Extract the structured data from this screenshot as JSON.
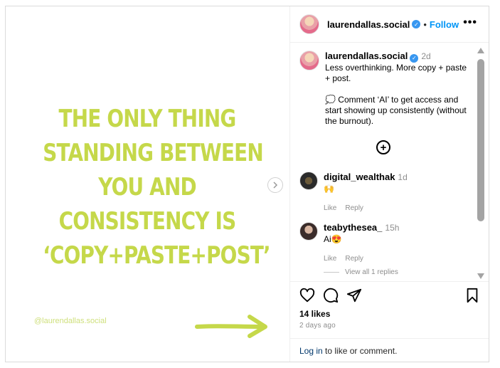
{
  "post": {
    "headline_lines": [
      "THE ONLY THING",
      "STANDING BETWEEN",
      "YOU AND",
      "CONSISTENCY IS",
      "‘COPY+PASTE+POST’"
    ],
    "watermark": "@laurendallas.social",
    "headline_color": "#c5d84a"
  },
  "header": {
    "username": "laurendallas.social",
    "separator": "•",
    "follow_label": "Follow",
    "more_label": "•••"
  },
  "caption": {
    "username": "laurendallas.social",
    "time": "2d",
    "text": "Less overthinking. More copy + paste + post.",
    "text2": "💭 Comment ‘AI’ to get access and start showing up consistently (without the burnout).",
    "add_label": "+"
  },
  "comments": [
    {
      "username": "digital_wealthak",
      "time": "1d",
      "text": "🙌",
      "like": "Like",
      "reply": "Reply"
    },
    {
      "username": "teabythesea_",
      "time": "15h",
      "text": "Ai😍",
      "like": "Like",
      "reply": "Reply"
    }
  ],
  "view_replies": "View all 1 replies",
  "likes": "14 likes",
  "ago": "2 days ago",
  "login": {
    "link": "Log in",
    "rest": " to like or comment."
  },
  "colors": {
    "accent": "#0095f6",
    "verified": "#3897f0",
    "link": "#00376b"
  },
  "icons": [
    "heart-icon",
    "comment-icon",
    "share-icon",
    "bookmark-icon",
    "chevron-right-icon",
    "verified-icon",
    "add-circle-icon"
  ]
}
